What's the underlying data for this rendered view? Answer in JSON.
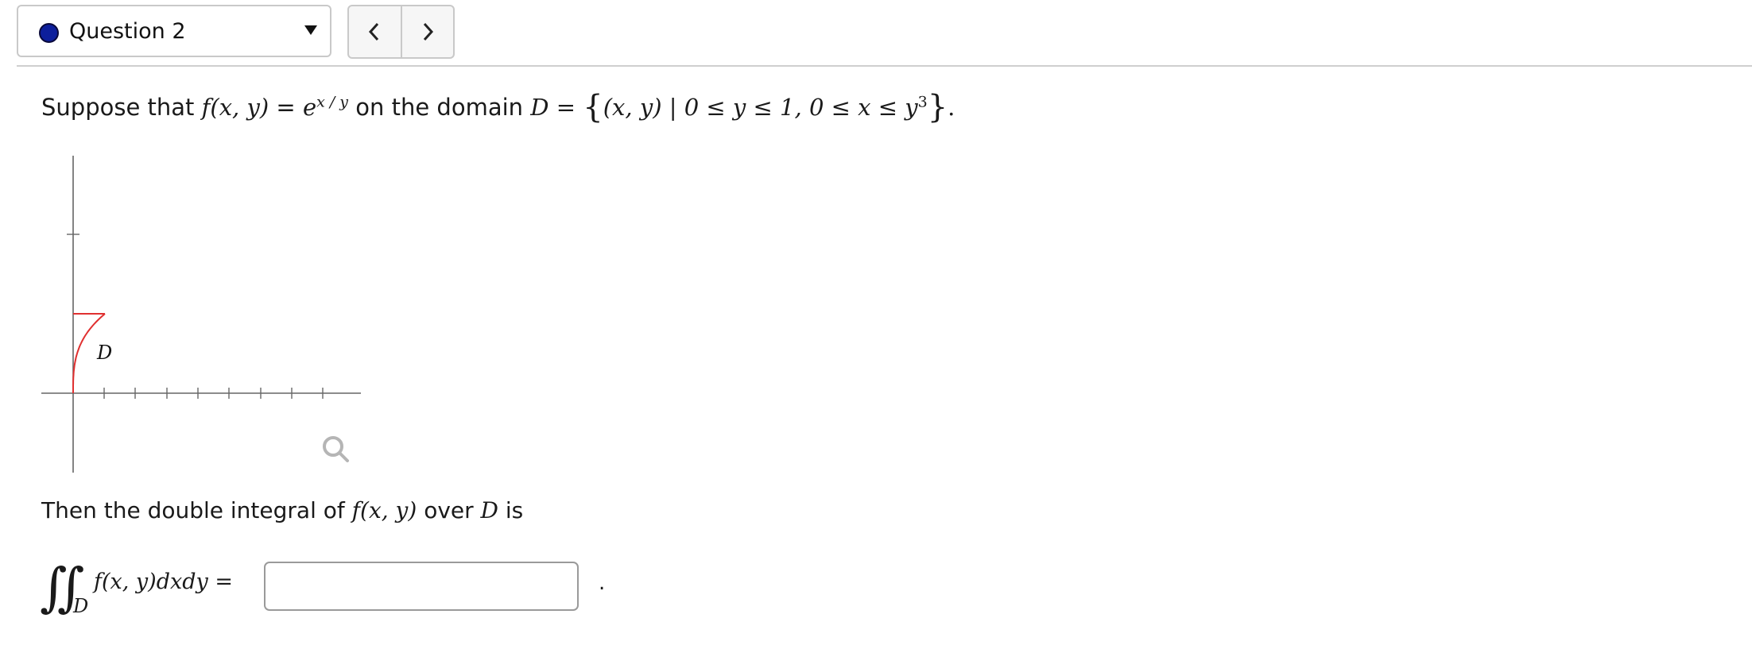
{
  "question_selector": {
    "label": "Question 2",
    "status_color": "#0d1f9c"
  },
  "nav": {
    "prev_icon": "chevron-left-icon",
    "next_icon": "chevron-right-icon"
  },
  "problem": {
    "prefix": "Suppose that",
    "function_lhs": "f(x, y)",
    "equals": "=",
    "function_base": "e",
    "function_exponent": "x / y",
    "middle": "on the domain",
    "domain_symbol": "D",
    "domain_equals": "=",
    "domain_open": "{",
    "domain_pair": "(x, y)",
    "domain_bar": "|",
    "domain_cond1": "0 ≤ y ≤ 1, 0 ≤ x ≤ y",
    "domain_cond1_exp": "3",
    "domain_close": "}",
    "end": "."
  },
  "graph": {
    "region_label": "D",
    "region_color": "#e03030",
    "zoom_icon": "magnify-icon"
  },
  "integral": {
    "intro_text": "Then the double integral of",
    "intro_fn": "f(x, y)",
    "intro_over": "over",
    "intro_domain": "D",
    "intro_is": "is",
    "sign": "∬",
    "subscript": "D",
    "integrand": "f(x, y)dxdy =",
    "answer_value": "",
    "trailing": "."
  }
}
